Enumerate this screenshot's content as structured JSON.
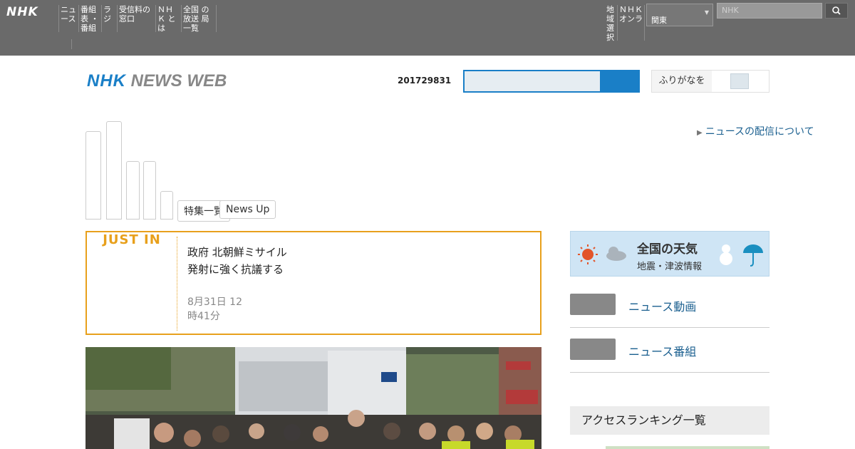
{
  "global_nav": {
    "logo": "NHK",
    "items": [
      "ニュ ース",
      "番組表 ・番組",
      "ラジ",
      "受信料の 窓口",
      "ＮＨＫ とは",
      "全国 の放送 局一覧"
    ],
    "right_items": [
      "地域 選択",
      "ＮＨＫ オンラ"
    ],
    "region": "関東",
    "search_placeholder": "NHK"
  },
  "header": {
    "brand_nhk": "NHK",
    "brand_rest": "NEWS WEB",
    "date_code": "201729831",
    "toggle_label": "ふりがなを"
  },
  "tabs": {
    "buttons": [
      "特集一覧",
      "News Up"
    ]
  },
  "right_link": "ニュースの配信について",
  "just_in": {
    "tag": "JUST IN",
    "title_line1": "政府 北朝鮮ミサイル",
    "title_line2": "発射に強く抗議する",
    "time_line1": "8月31日 12",
    "time_line2": "時41分"
  },
  "weather": {
    "title": "全国の天気",
    "subtitle": "地震・津波情報"
  },
  "services": [
    {
      "label": "ニュース動画"
    },
    {
      "label": "ニュース番組"
    }
  ],
  "ranking_heading": "アクセスランキング一覧",
  "colors": {
    "accent": "#e8a01c",
    "brand_blue": "#1a7fc7",
    "topbar": "#6a6a6a"
  }
}
